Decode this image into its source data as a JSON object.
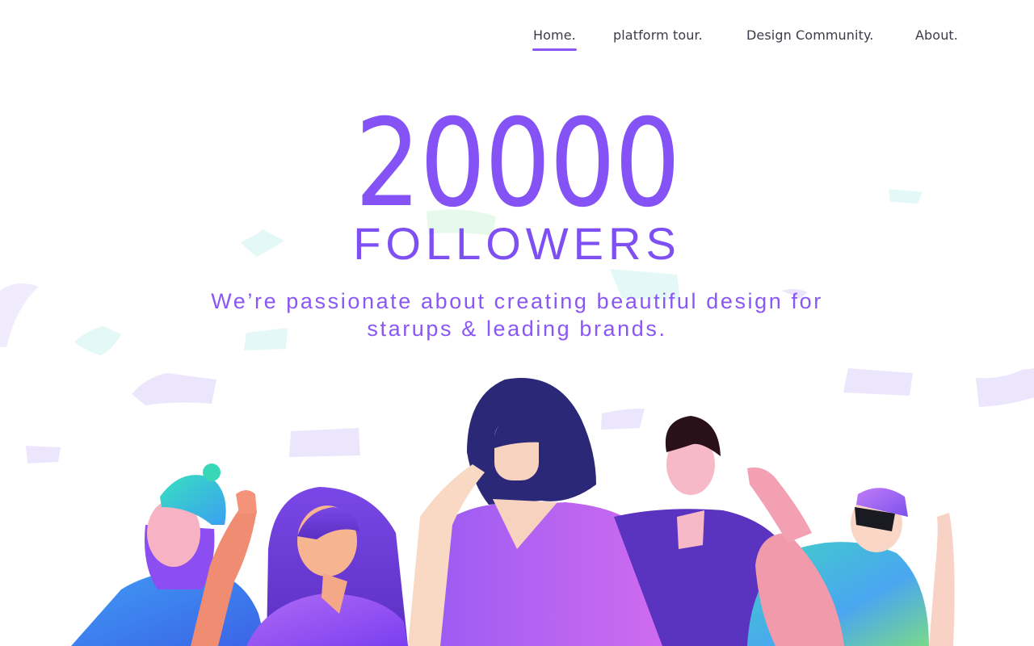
{
  "nav": {
    "items": [
      {
        "label": "Home.",
        "active": true
      },
      {
        "label": "platform tour.",
        "active": false
      },
      {
        "label": "Design Community.",
        "active": false
      },
      {
        "label": "About.",
        "active": false
      }
    ]
  },
  "hero": {
    "number": "20000",
    "label": "FOLLOWERS",
    "tagline_line1": "We’re passionate about creating beautiful design for",
    "tagline_line2": "starups & leading brands."
  },
  "colors": {
    "accent": "#8452f5",
    "nav_text": "#3b3b4a",
    "confetti_lilac": "#ece6fd",
    "confetti_mint": "#e3f8f7"
  },
  "illustration": {
    "subject": "group of stylized people celebrating with confetti"
  }
}
